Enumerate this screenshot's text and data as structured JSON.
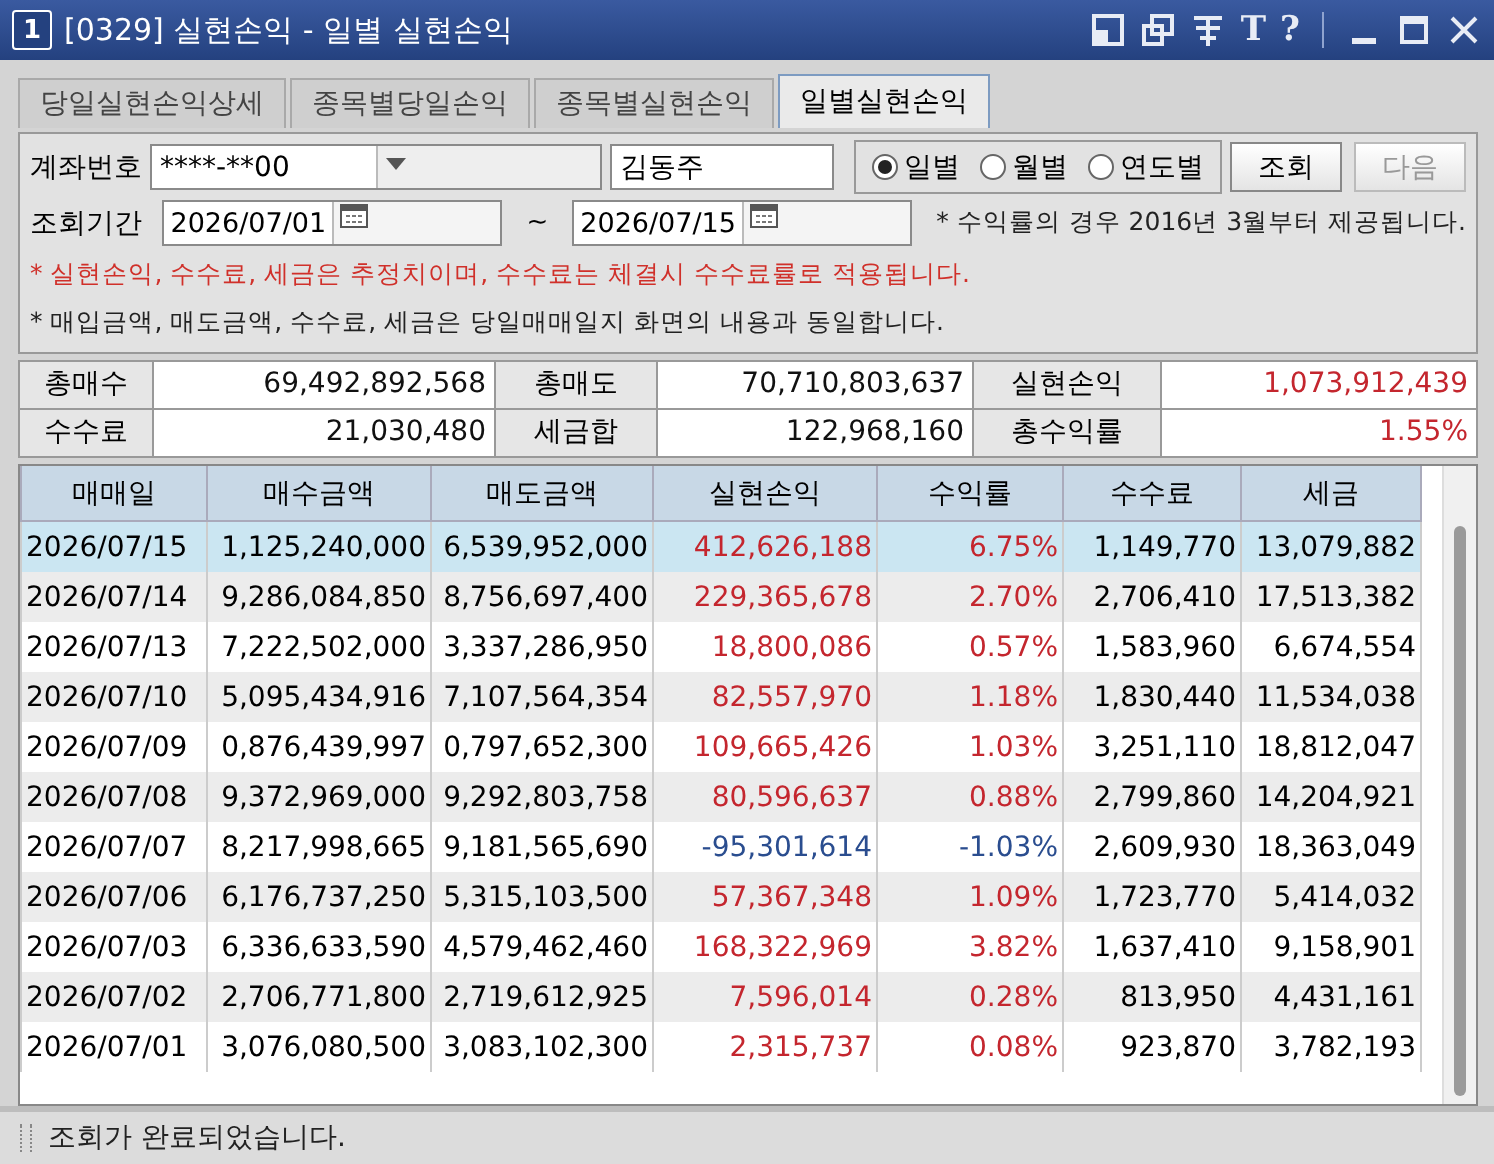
{
  "window": {
    "badge": "1",
    "title": "[0329] 실현손익 - 일별 실현손익",
    "tool_glyphs": [
      "T",
      "?"
    ]
  },
  "tabs": [
    {
      "label": "당일실현손익상세",
      "selected": false
    },
    {
      "label": "종목별당일손익",
      "selected": false
    },
    {
      "label": "종목별실현손익",
      "selected": false
    },
    {
      "label": "일별실현손익",
      "selected": true
    }
  ],
  "query": {
    "account_label": "계좌번호",
    "account": "****-**00",
    "holder": "김동주",
    "periods": [
      {
        "label": "일별",
        "selected": true
      },
      {
        "label": "월별",
        "selected": false
      },
      {
        "label": "연도별",
        "selected": false
      }
    ],
    "buttons": [
      {
        "label": "조회",
        "disabled": false
      },
      {
        "label": "다음",
        "disabled": true
      }
    ],
    "range_label": "조회기간",
    "from": "2026/07/01",
    "separator": "~",
    "to": "2026/07/15",
    "notes": [
      {
        "text": "* 수익률의 경우 2016년 3월부터 제공됩니다.",
        "kind": "info"
      },
      {
        "text": "* 실현손익, 수수료, 세금은 추정치이며, 수수료는 체결시 수수료률로 적용됩니다.",
        "kind": "warning"
      },
      {
        "text": "* 매입금액, 매도금액, 수수료, 세금은 당일매매일지 화면의 내용과 동일합니다.",
        "kind": "info"
      }
    ]
  },
  "summary": [
    {
      "label": "총매수",
      "value": "69,492,892,568",
      "color": "#111111"
    },
    {
      "label": "총매도",
      "value": "70,710,803,637",
      "color": "#111111"
    },
    {
      "label": "실현손익",
      "value": "1,073,912,439",
      "color": "#c4262e"
    },
    {
      "label": "수수료",
      "value": "21,030,480",
      "color": "#111111"
    },
    {
      "label": "세금합",
      "value": "122,968,160",
      "color": "#111111"
    },
    {
      "label": "총수익률",
      "value": "1.55%",
      "color": "#c4262e"
    }
  ],
  "table": {
    "columns": [
      "매매일",
      "매수금액",
      "매도금액",
      "실현손익",
      "수익률",
      "수수료",
      "세금"
    ],
    "rows": [
      {
        "cells": [
          "2026/07/15",
          "1,125,240,000",
          "6,539,952,000",
          "412,626,188",
          "6.75%",
          "1,149,770",
          "13,079,882"
        ],
        "color": "#c4262e",
        "selected": true
      },
      {
        "cells": [
          "2026/07/14",
          "9,286,084,850",
          "8,756,697,400",
          "229,365,678",
          "2.70%",
          "2,706,410",
          "17,513,382"
        ],
        "color": "#c4262e",
        "selected": false
      },
      {
        "cells": [
          "2026/07/13",
          "7,222,502,000",
          "3,337,286,950",
          "18,800,086",
          "0.57%",
          "1,583,960",
          "6,674,554"
        ],
        "color": "#c4262e",
        "selected": false
      },
      {
        "cells": [
          "2026/07/10",
          "5,095,434,916",
          "7,107,564,354",
          "82,557,970",
          "1.18%",
          "1,830,440",
          "11,534,038"
        ],
        "color": "#c4262e",
        "selected": false
      },
      {
        "cells": [
          "2026/07/09",
          "0,876,439,997",
          "0,797,652,300",
          "109,665,426",
          "1.03%",
          "3,251,110",
          "18,812,047"
        ],
        "color": "#c4262e",
        "selected": false
      },
      {
        "cells": [
          "2026/07/08",
          "9,372,969,000",
          "9,292,803,758",
          "80,596,637",
          "0.88%",
          "2,799,860",
          "14,204,921"
        ],
        "color": "#c4262e",
        "selected": false
      },
      {
        "cells": [
          "2026/07/07",
          "8,217,998,665",
          "9,181,565,690",
          "-95,301,614",
          "-1.03%",
          "2,609,930",
          "18,363,049"
        ],
        "color": "#2a4d8f",
        "selected": false
      },
      {
        "cells": [
          "2026/07/06",
          "6,176,737,250",
          "5,315,103,500",
          "57,367,348",
          "1.09%",
          "1,723,770",
          "5,414,032"
        ],
        "color": "#c4262e",
        "selected": false
      },
      {
        "cells": [
          "2026/07/03",
          "6,336,633,590",
          "4,579,462,460",
          "168,322,969",
          "3.82%",
          "1,637,410",
          "9,158,901"
        ],
        "color": "#c4262e",
        "selected": false
      },
      {
        "cells": [
          "2026/07/02",
          "2,706,771,800",
          "2,719,612,925",
          "7,596,014",
          "0.28%",
          "813,950",
          "4,431,161"
        ],
        "color": "#c4262e",
        "selected": false
      },
      {
        "cells": [
          "2026/07/01",
          "3,076,080,500",
          "3,083,102,300",
          "2,315,737",
          "0.08%",
          "923,870",
          "3,782,193"
        ],
        "color": "#c4262e",
        "selected": false
      }
    ]
  },
  "status_bar": "조회가 완료되었습니다."
}
